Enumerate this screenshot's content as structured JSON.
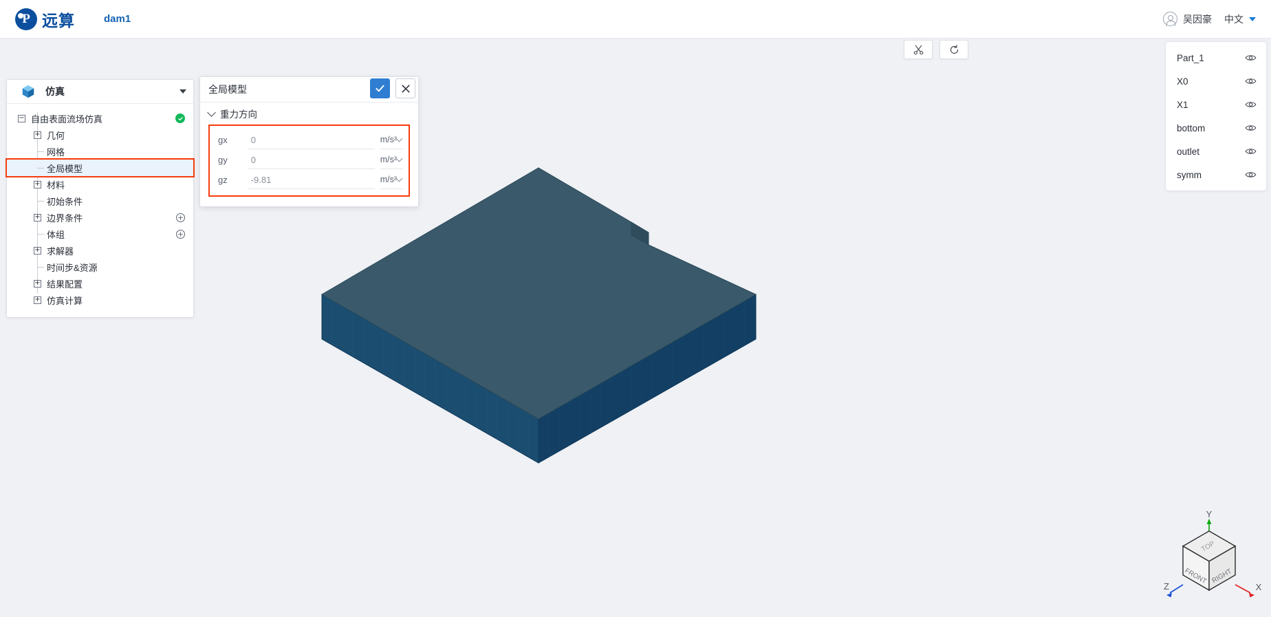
{
  "header": {
    "brand_letter": "P",
    "brand_name": "远算",
    "project_title": "dam1",
    "user_name": "吴因豪",
    "language": "中文",
    "avatar_icon": "user-avatar-icon",
    "caret_icon": "chevron-down-icon"
  },
  "tree_panel": {
    "title": "仿真",
    "cube_icon": "cube-icon",
    "collapse_icon": "chevron-down-icon",
    "items": [
      {
        "label": "自由表面流场仿真",
        "depth": 0,
        "toggle": "minus",
        "status": "ok"
      },
      {
        "label": "几何",
        "depth": 1,
        "toggle": "plus"
      },
      {
        "label": "网格",
        "depth": 1,
        "toggle": "leaf"
      },
      {
        "label": "全局模型",
        "depth": 1,
        "toggle": "leaf",
        "selected": true,
        "highlighted": true
      },
      {
        "label": "材料",
        "depth": 1,
        "toggle": "plus"
      },
      {
        "label": "初始条件",
        "depth": 1,
        "toggle": "leaf"
      },
      {
        "label": "边界条件",
        "depth": 1,
        "toggle": "plus",
        "add": true
      },
      {
        "label": "体组",
        "depth": 1,
        "toggle": "leaf",
        "add": true
      },
      {
        "label": "求解器",
        "depth": 1,
        "toggle": "plus"
      },
      {
        "label": "时间步&资源",
        "depth": 1,
        "toggle": "leaf"
      },
      {
        "label": "结果配置",
        "depth": 1,
        "toggle": "plus"
      },
      {
        "label": "仿真计算",
        "depth": 1,
        "toggle": "plus"
      }
    ]
  },
  "dialog": {
    "title": "全局模型",
    "confirm_icon": "check-icon",
    "cancel_icon": "close-icon",
    "section": {
      "label": "重力方向",
      "chevron_icon": "chevron-down-icon"
    },
    "fields": [
      {
        "label": "gx",
        "value": "0",
        "unit": "m/s²"
      },
      {
        "label": "gy",
        "value": "0",
        "unit": "m/s²"
      },
      {
        "label": "gz",
        "value": "-9.81",
        "unit": "m/s²"
      }
    ],
    "highlight_color": "#f73b0c",
    "confirm_color": "#2f7ed2"
  },
  "viewport_toolbar": {
    "buttons": [
      {
        "name": "clip-section-button",
        "icon": "scissors-icon"
      },
      {
        "name": "reset-view-button",
        "icon": "refresh-icon"
      }
    ]
  },
  "visibility_panel": {
    "eye_icon": "eye-icon",
    "items": [
      {
        "name": "Part_1"
      },
      {
        "name": "X0"
      },
      {
        "name": "X1"
      },
      {
        "name": "bottom"
      },
      {
        "name": "outlet"
      },
      {
        "name": "symm"
      }
    ]
  },
  "view_cube": {
    "faces": {
      "top": "TOP",
      "front": "FRONT",
      "right": "RIGHT"
    },
    "axes": {
      "x": "X",
      "y": "Y",
      "z": "Z"
    },
    "axis_colors": {
      "x": "#e02020",
      "y": "#10a810",
      "z": "#1a4fd6"
    }
  },
  "model": {
    "top_color": "#3b5a6b",
    "side_color": "#1c4f73",
    "front_color": "#11486e",
    "edge_color": "#0f3a56"
  }
}
